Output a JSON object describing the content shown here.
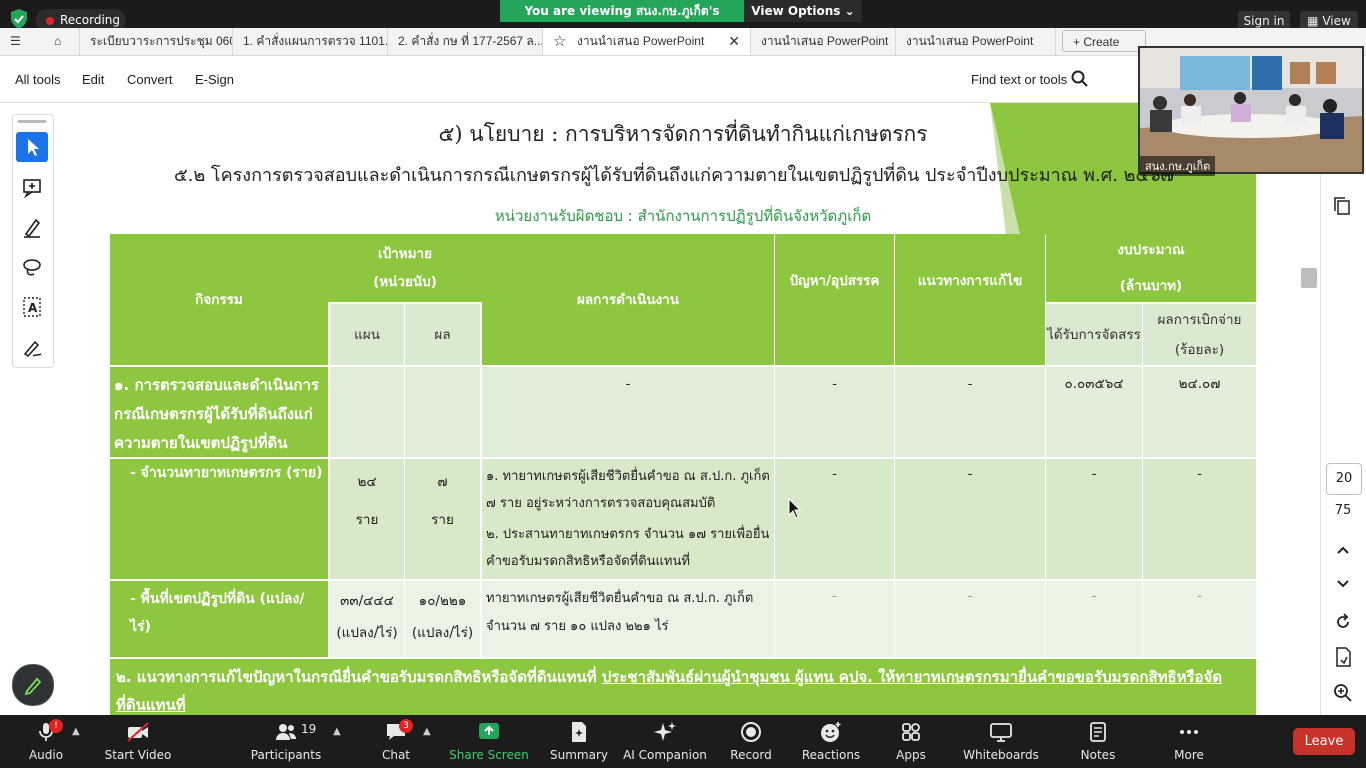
{
  "top_bar": {
    "recording_label": "Recording",
    "viewing_banner": "You are viewing สนง.กษ.ภูเก็ต's screen",
    "view_options_label": "View Options",
    "sign_in_label": "Sign in",
    "view_label": "View"
  },
  "tabs": [
    {
      "label": "ระเบียบวาระการประชุม 060..."
    },
    {
      "label": "1. คำสั่งแผนการตรวจ 1101..."
    },
    {
      "label": "2. คำสั่ง กษ ที่ 177-2567 ล..."
    },
    {
      "label": "งานนำเสนอ PowerPoint"
    },
    {
      "label": "งานนำเสนอ PowerPoint"
    },
    {
      "label": "งานนำเสนอ PowerPoint"
    }
  ],
  "create_label": "Create",
  "toolbar": {
    "all_tools": "All tools",
    "edit": "Edit",
    "convert": "Convert",
    "esign": "E-Sign",
    "find": "Find text or tools"
  },
  "document": {
    "title": "๕) นโยบาย : การบริหารจัดการที่ดินทำกินแก่เกษตรกร",
    "subtitle": "๕.๒ โครงการตรวจสอบและดำเนินการกรณีเกษตรกรผู้ได้รับที่ดินถึงแก่ความตายในเขตปฏิรูปที่ดิน ประจำปีงบประมาณ พ.ศ. ๒๕๖๗",
    "responsible": "หน่วยงานรับผิดชอบ : สำนักงานการปฏิรูปที่ดินจังหวัดภูเก็ต",
    "headers": {
      "activity": "กิจกรรม",
      "target_line1": "เป้าหมาย",
      "target_line2": "(หน่วยนับ)",
      "plan": "แผน",
      "result": "ผล",
      "performance": "ผลการดำเนินงาน",
      "problems": "ปัญหา/อุปสรรค",
      "solutions": "แนวทางการแก้ไข",
      "budget_line1": "งบประมาณ",
      "budget_line2": "(ล้านบาท)",
      "allocated": "ได้รับการจัดสรร",
      "disbursed_line1": "ผลการเบิกจ่าย",
      "disbursed_line2": "(ร้อยละ)"
    },
    "rows": [
      {
        "activity": "๑. การตรวจสอบและดำเนินการกรณีเกษตรกรผู้ได้รับที่ดินถึงแก่ความตายในเขตปฏิรูปที่ดิน",
        "plan": "",
        "result": "",
        "performance": "-",
        "problems": "-",
        "solutions": "-",
        "allocated": "๐.๐๓๕๖๔",
        "disbursed": "๒๔.๐๗"
      },
      {
        "activity": "- จำนวนทายาทเกษตรกร (ราย)",
        "plan_value": "๒๔",
        "plan_unit": "ราย",
        "result_value": "๗",
        "result_unit": "ราย",
        "performance_1": "๑. ทายาทเกษตรผู้เสียชีวิตยื่นคำขอ ณ ส.ป.ก. ภูเก็ต ๗ ราย อยู่ระหว่างการตรวจสอบคุณสมบัติ",
        "performance_2": "๒. ประสานทายาทเกษตรกร จำนวน ๑๗ รายเพื่อยื่นคำขอรับมรดกสิทธิหรือจัดที่ดินแทนที่",
        "problems": "-",
        "solutions": "-",
        "allocated": "-",
        "disbursed": "-"
      },
      {
        "activity": "- พื้นที่เขตปฏิรูปที่ดิน (แปลง/ไร่)",
        "plan_value": "๓๓/๔๔๔",
        "plan_unit": "(แปลง/ไร่)",
        "result_value": "๑๐/๒๒๑",
        "result_unit": "(แปลง/ไร่)",
        "performance": "ทายาทเกษตรผู้เสียชีวิตยื่นคำขอ ณ ส.ป.ก. ภูเก็ต จำนวน ๗ ราย ๑๐ แปลง ๒๒๑ ไร่",
        "problems": "-",
        "solutions": "-",
        "allocated": "-",
        "disbursed": "-"
      }
    ],
    "footer_prefix": "๒. แนวทางการแก้ไขปัญหาในกรณียื่นคำขอรับมรดกสิทธิหรือจัดที่ดินแทนที่",
    "footer_underlined": "ประชาสัมพันธ์ผ่านผู้นำชุมชน ผู้แทน คปจ. ให้ทายาทเกษตรกรมายื่นคำขอขอรับมรดกสิทธิหรือจัดที่ดินแทนที่"
  },
  "video": {
    "name": "สนง.กษ.ภูเก็ต"
  },
  "page_nav": {
    "current": "20",
    "total": "75"
  },
  "bottom_bar": {
    "audio": "Audio",
    "audio_badge": "!",
    "start_video": "Start Video",
    "participants": "Participants",
    "participants_count": "19",
    "chat": "Chat",
    "chat_badge": "3",
    "share_screen": "Share Screen",
    "summary": "Summary",
    "ai_companion": "AI Companion",
    "record": "Record",
    "reactions": "Reactions",
    "apps": "Apps",
    "whiteboards": "Whiteboards",
    "notes": "Notes",
    "more": "More",
    "leave": "Leave"
  },
  "colors": {
    "table_header": "#8dc63f",
    "subtitle_green": "#2e9a48",
    "share_green": "#23a55a",
    "leave_red": "#c9312b"
  }
}
